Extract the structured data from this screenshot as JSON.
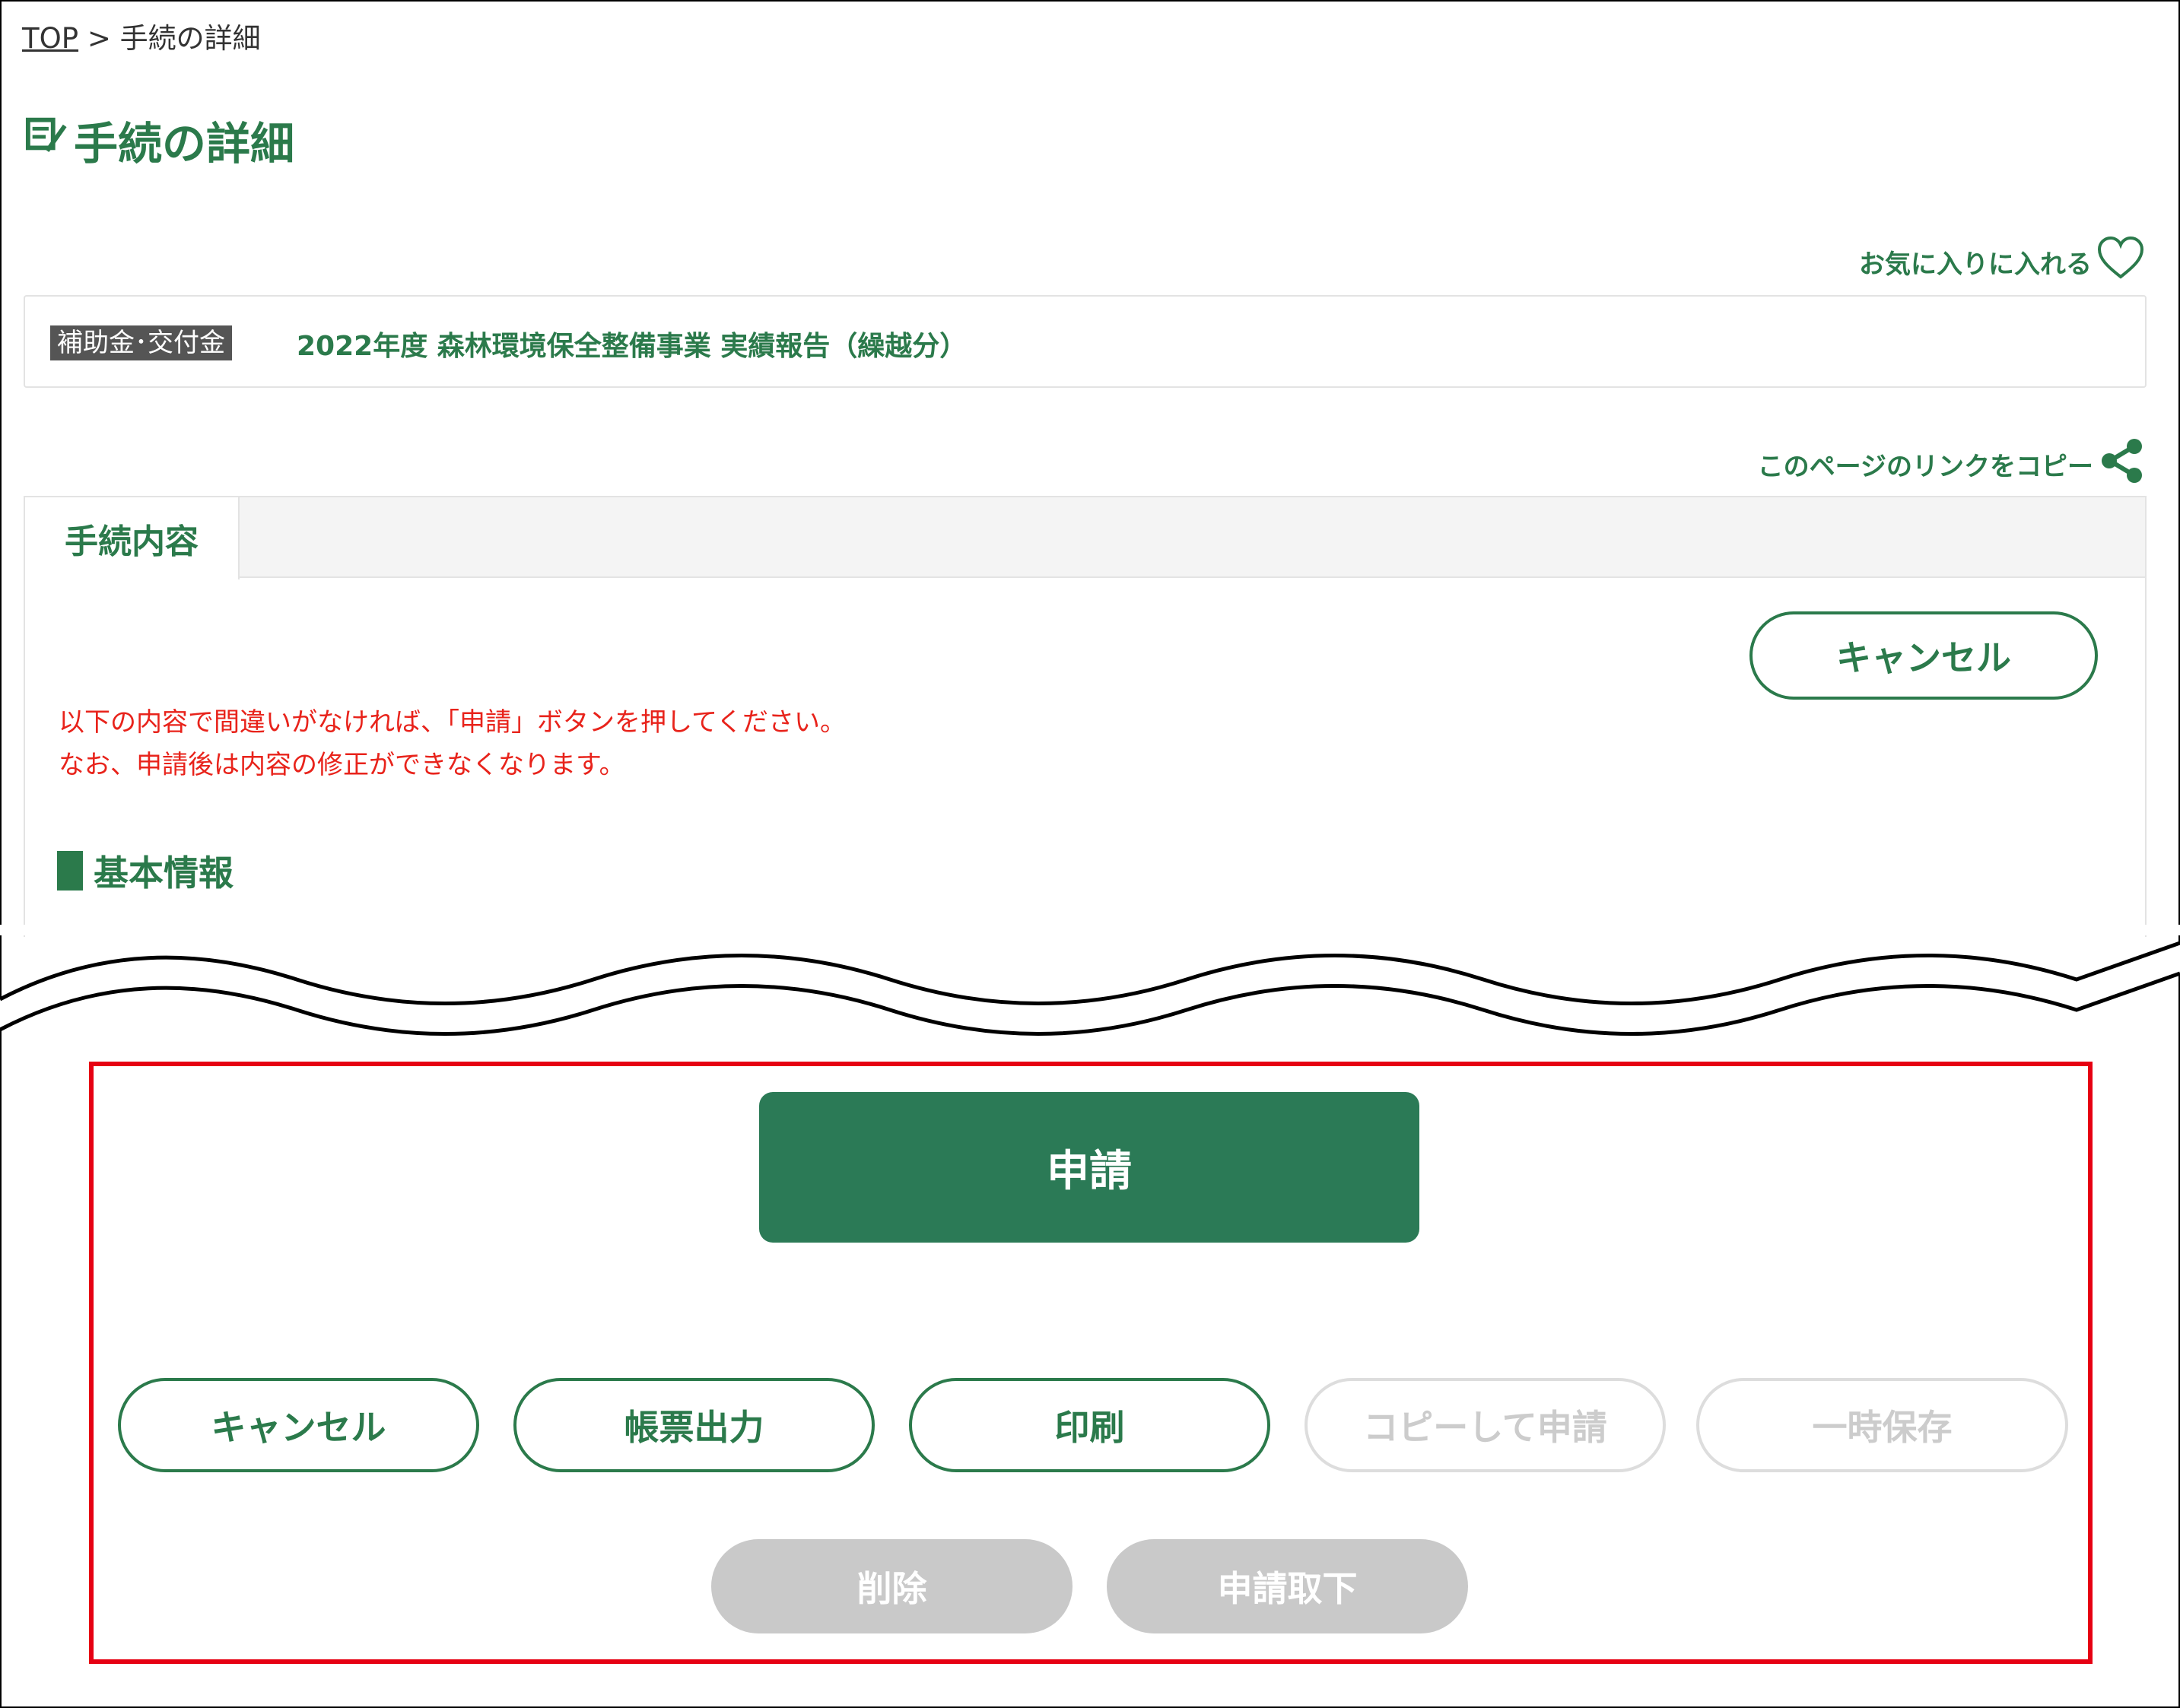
{
  "breadcrumb": {
    "top": "TOP",
    "separator": ">",
    "current": "手続の詳細"
  },
  "page_title": "手続の詳細",
  "favorite": {
    "label": "お気に入りに入れる",
    "icon": "heart-outline-icon"
  },
  "procedure": {
    "category": "補助金･交付金",
    "title": "2022年度 森林環境保全整備事業 実績報告（繰越分）"
  },
  "copy_link": {
    "label": "このページのリンクをコピー",
    "icon": "share-icon"
  },
  "tabs": [
    {
      "label": "手続内容",
      "active": true
    }
  ],
  "panel": {
    "cancel_label": "キャンセル",
    "warning_line1": "以下の内容で間違いがなければ、「申請」ボタンを押してください。",
    "warning_line2": "なお、申請後は内容の修正ができなくなります。",
    "section_heading": "基本情報"
  },
  "actions": {
    "apply": "申請",
    "cancel": "キャンセル",
    "form_output": "帳票出力",
    "print": "印刷",
    "copy_apply": "コピーして申請",
    "temp_save": "一時保存",
    "delete": "削除",
    "withdraw": "申請取下"
  },
  "colors": {
    "brand_green": "#2b7a4b",
    "primary_button": "#2b7a56",
    "warning_red": "#e8231b",
    "highlight_red": "#e60012",
    "disabled_gray": "#c9c9c9"
  }
}
